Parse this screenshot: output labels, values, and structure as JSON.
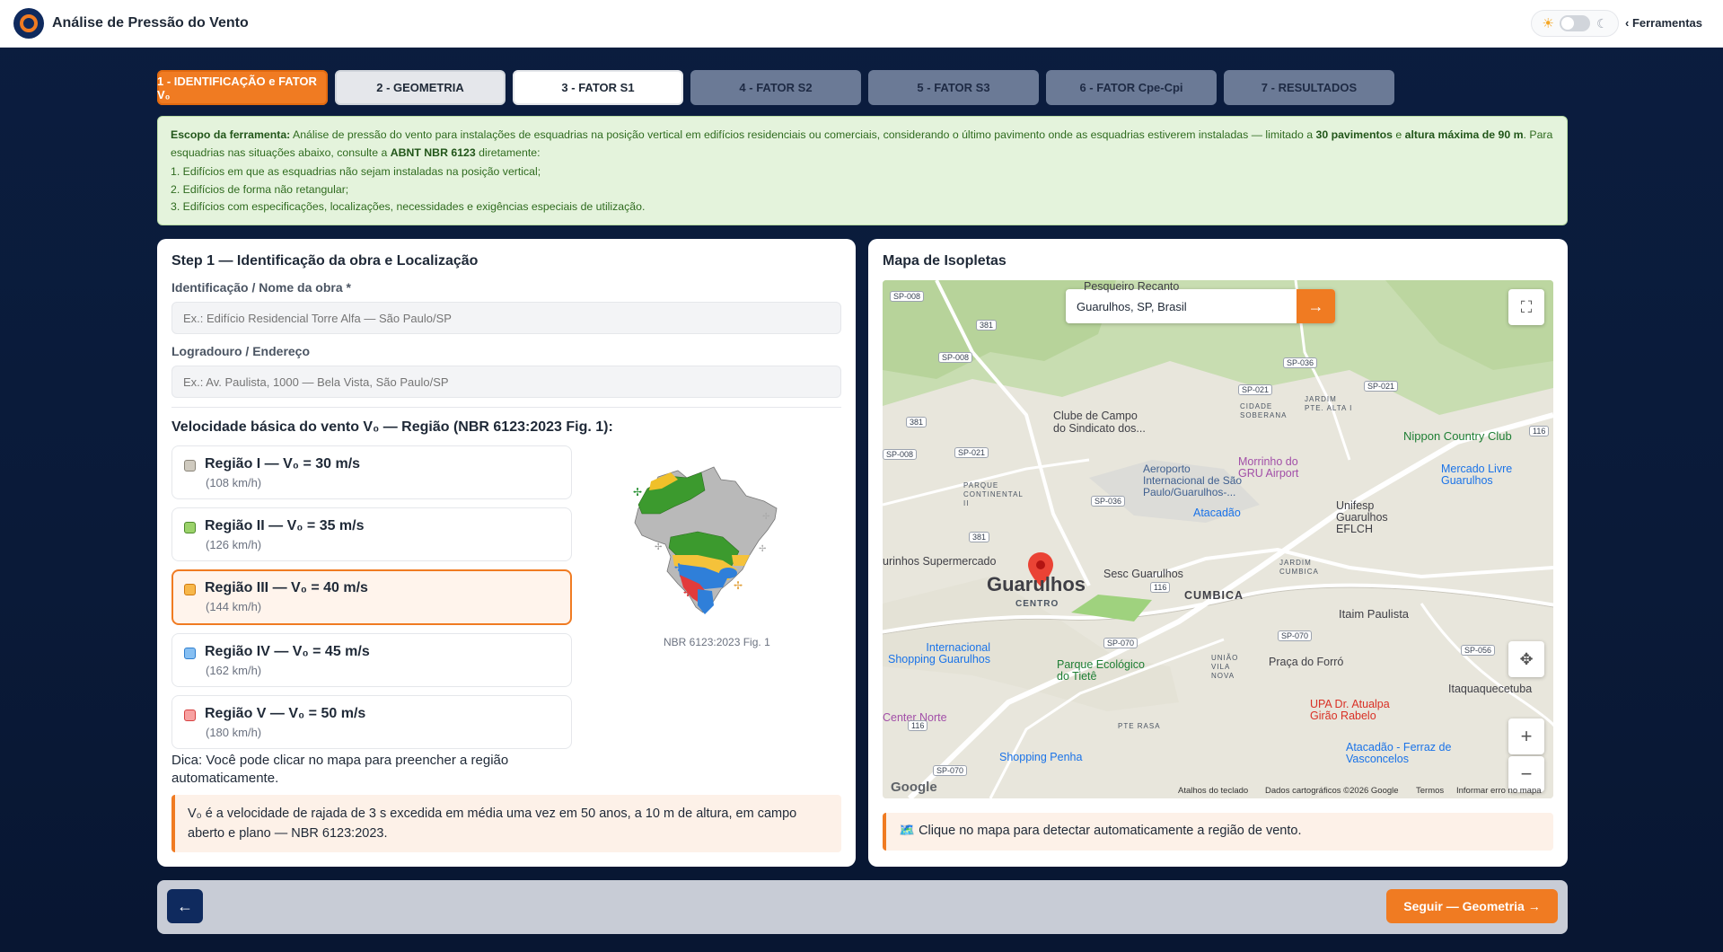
{
  "app": {
    "title": "Análise de Pressão do Vento",
    "tools_label": "Ferramentas"
  },
  "tabs": [
    {
      "label": "1 - IDENTIFICAÇÃO e FATOR V₀",
      "state": "active"
    },
    {
      "label": "2 - GEOMETRIA",
      "state": "available"
    },
    {
      "label": "3 - FATOR S1",
      "state": "available"
    },
    {
      "label": "4 - FATOR S2",
      "state": "disabled"
    },
    {
      "label": "5 - FATOR S3",
      "state": "disabled"
    },
    {
      "label": "6 - FATOR Cpe-Cpi",
      "state": "disabled"
    },
    {
      "label": "7 - RESULTADOS",
      "state": "disabled"
    }
  ],
  "scope": {
    "label": "Escopo da ferramenta:",
    "text1": "Análise de pressão do vento para instalações de esquadrias na posição vertical em edifícios residenciais ou comerciais, considerando o último pavimento onde as esquadrias estiverem instaladas — limitado a",
    "bold1": "30 pavimentos",
    "text2": "e",
    "bold2": "altura máxima de 90 m",
    "text3": ". Para esquadrias nas situações abaixo, consulte a",
    "bold3": "ABNT NBR 6123",
    "text4": "diretamente:",
    "items": [
      "1. Edifícios em que as esquadrias não sejam instaladas na posição vertical;",
      "2. Edifícios de forma não retangular;",
      "3. Edifícios com especificações, localizações, necessidades e exigências especiais de utilização."
    ]
  },
  "step1": {
    "title": "Step 1 — Identificação da obra e Localização",
    "name_label": "Identificação / Nome da obra *",
    "name_placeholder": "Ex.: Edifício Residencial Torre Alfa — São Paulo/SP",
    "address_label": "Logradouro / Endereço",
    "address_placeholder": "Ex.: Av. Paulista, 1000 — Bela Vista, São Paulo/SP",
    "speed_title": "Velocidade básica do vento V₀ — Região (NBR 6123:2023 Fig. 1):",
    "regions": [
      {
        "name": "Região I — V₀ = 30 m/s",
        "kmh": "(108 km/h)",
        "color": "#cfcabf",
        "border": "#8a8579",
        "selected": false
      },
      {
        "name": "Região II — V₀ = 35 m/s",
        "kmh": "(126 km/h)",
        "color": "#9bd26a",
        "border": "#4d8a2a",
        "selected": false
      },
      {
        "name": "Região III — V₀ = 40 m/s",
        "kmh": "(144 km/h)",
        "color": "#f7b74a",
        "border": "#d17a0e",
        "selected": true
      },
      {
        "name": "Região IV — V₀ = 45 m/s",
        "kmh": "(162 km/h)",
        "color": "#86bff2",
        "border": "#2f7fcf",
        "selected": false
      },
      {
        "name": "Região V — V₀ = 50 m/s",
        "kmh": "(180 km/h)",
        "color": "#f7a1a1",
        "border": "#d64141",
        "selected": false
      }
    ],
    "map_caption": "NBR 6123:2023 Fig. 1",
    "tip": "Dica: Você pode clicar no mapa para preencher a região automaticamente.",
    "note": "V₀ é a velocidade de rajada de 3 s excedida em média uma vez em 50 anos, a 10 m de altura, em campo aberto e plano — NBR 6123:2023."
  },
  "isopletas": {
    "title": "Mapa de Isopletas",
    "search_value": "Guarulhos, SP, Brasil",
    "go_icon": "arrow-right-icon",
    "city": "Guarulhos",
    "centro": "CENTRO",
    "labels": [
      "Pesqueiro Recanto",
      "Clube de Campo do Sindicato dos...",
      "Nippon Country Club",
      "Aeroporto Internacional de São Paulo/Guarulhos-...",
      "Morrinho do GRU Airport",
      "Mercado Livre Guarulhos",
      "Atacadão",
      "Unifesp Guarulhos EFLCH",
      "urinhos Supermercado",
      "Sesc Guarulhos",
      "CUMBICA",
      "Itaim Paulista",
      "Internacional Shopping Guarulhos",
      "Parque Ecológico do Tietê",
      "Praça do Forró",
      "Itaquaquecetuba",
      "Center Norte",
      "UPA Dr. Atualpa Girão Rabelo",
      "Shopping Penha",
      "Atacadão - Ferraz de Vasconcelos"
    ],
    "districts": [
      "JARDIM PTE. ALTA I",
      "CIDADE SOBERANA",
      "PARQUE CONTINENTAL II",
      "JARDIM CUMBICA",
      "UNIÃO VILA NOVA",
      "PTE RASA"
    ],
    "roads": [
      "SP-008",
      "381",
      "SP-008",
      "SP-036",
      "SP-021",
      "SP-021",
      "381",
      "SP-021",
      "SP-008",
      "116",
      "SP-036",
      "116",
      "SP-070",
      "SP-070",
      "SP-056",
      "116",
      "SP-070",
      "381"
    ],
    "footer": [
      "Atalhos do teclado",
      "Dados cartográficos ©2026 Google",
      "Termos",
      "Informar erro no mapa"
    ],
    "google": "Google",
    "hint": "🗺️ Clique no mapa para detectar automaticamente a região de vento."
  },
  "footer": {
    "back": "←",
    "next": "Seguir — Geometria →"
  },
  "colors": {
    "accent": "#f07b22",
    "navy": "#0f2a5e",
    "scope_bg": "#e4f3dc"
  }
}
